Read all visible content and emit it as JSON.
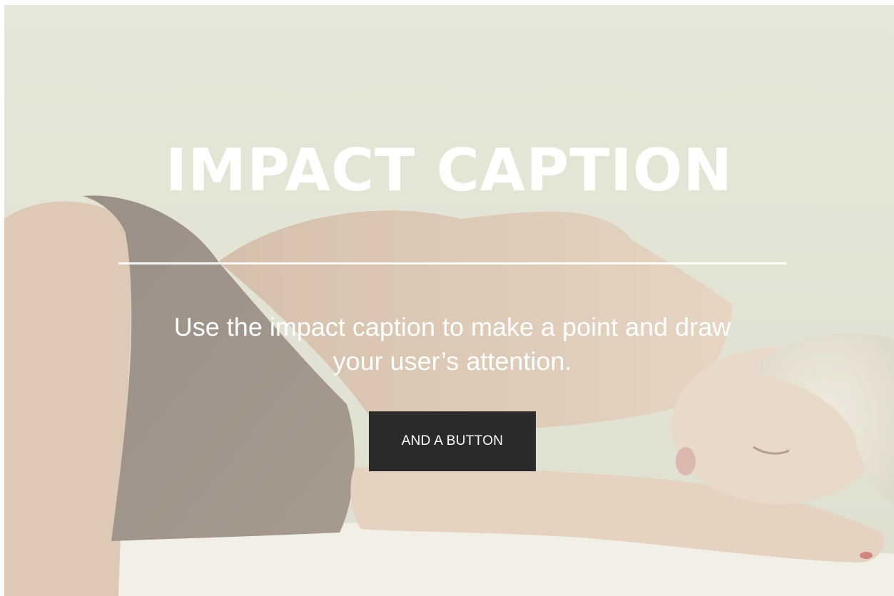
{
  "hero": {
    "title": "IMPACT CAPTION",
    "subtitle_line1": "Use the impact caption to make a point and draw",
    "subtitle_line2": "your user’s attention.",
    "button_label": "AND A BUTTON"
  },
  "colors": {
    "overlay_text": "#ffffff",
    "button_bg": "#2b2b2b",
    "button_text": "#ffffff",
    "backdrop": "#e2e2d4"
  }
}
